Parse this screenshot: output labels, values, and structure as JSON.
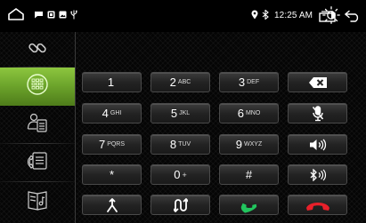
{
  "status_bar": {
    "time": "12:25 AM",
    "icons": [
      "home-icon",
      "chat-icon",
      "photo-icon",
      "image-icon",
      "usb-icon",
      "location-icon",
      "bluetooth-icon",
      "brightness-icon",
      "recent-apps-icon",
      "back-icon"
    ]
  },
  "sidebar": {
    "active": "dialpad",
    "items": [
      {
        "name": "link",
        "icon": "link-icon"
      },
      {
        "name": "dialpad",
        "icon": "dialpad-icon"
      },
      {
        "name": "contacts",
        "icon": "contacts-icon"
      },
      {
        "name": "call-log",
        "icon": "call-log-icon"
      },
      {
        "name": "music",
        "icon": "music-icon"
      }
    ]
  },
  "dialer": {
    "number": ""
  },
  "keypad": {
    "k1": {
      "digit": "1",
      "letters": ""
    },
    "k2": {
      "digit": "2",
      "letters": "ABC"
    },
    "k3": {
      "digit": "3",
      "letters": "DEF"
    },
    "k4": {
      "digit": "4",
      "letters": "GHI"
    },
    "k5": {
      "digit": "5",
      "letters": "JKL"
    },
    "k6": {
      "digit": "6",
      "letters": "MNO"
    },
    "k7": {
      "digit": "7",
      "letters": "PQRS"
    },
    "k8": {
      "digit": "8",
      "letters": "TUV"
    },
    "k9": {
      "digit": "9",
      "letters": "WXYZ"
    },
    "star": {
      "digit": "*",
      "letters": ""
    },
    "k0": {
      "digit": "0",
      "letters": "+"
    },
    "hash": {
      "digit": "#",
      "letters": ""
    }
  },
  "colors": {
    "accent_green": "#7cb335",
    "call_green": "#1db954",
    "hangup_red": "#e8202a"
  }
}
